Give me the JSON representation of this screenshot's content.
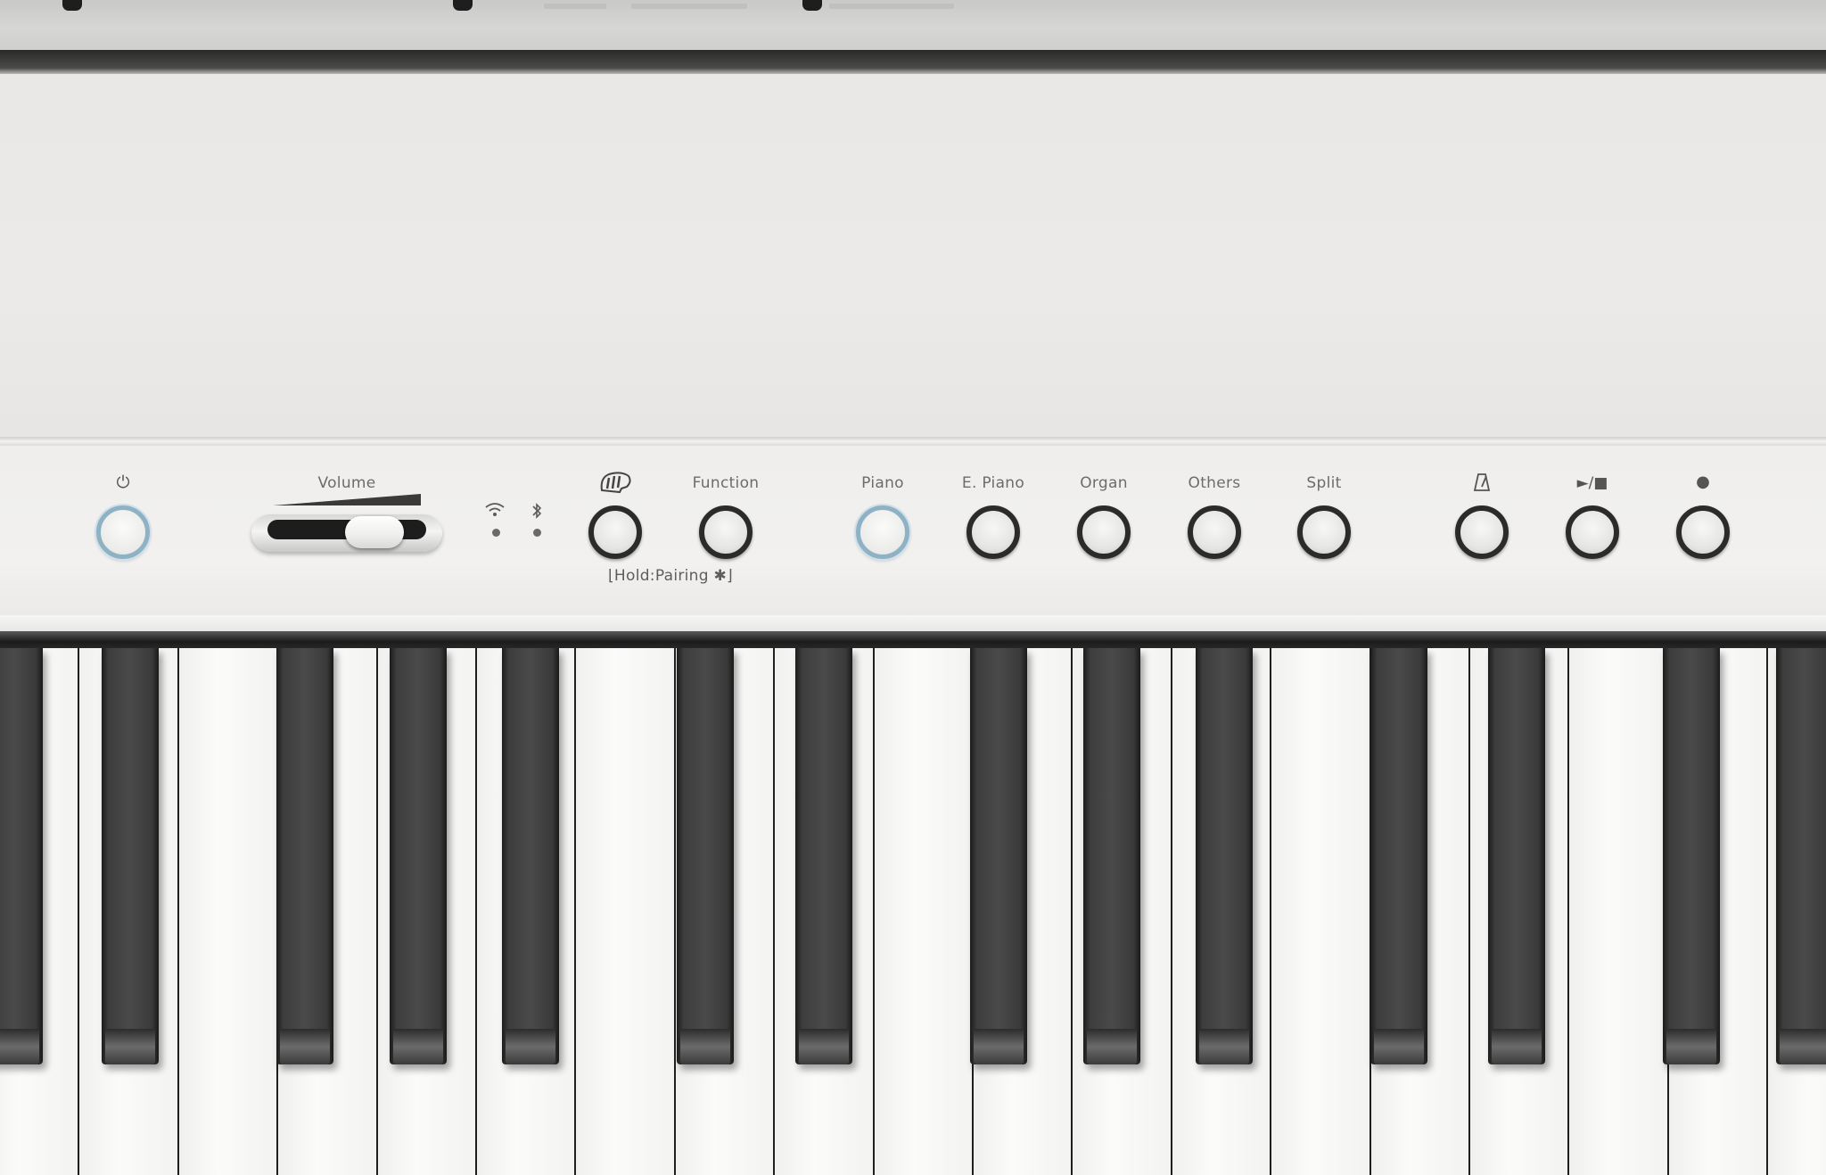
{
  "panel": {
    "power": {
      "symbol": "⏻",
      "lit": true
    },
    "volume": {
      "label": "Volume",
      "level": 0.78
    },
    "indicators": {
      "wifi_icon": "wifi-icon",
      "bluetooth_icon": "bluetooth-icon"
    },
    "twin_piano_icon": "twin-piano-icon",
    "function_label": "Function",
    "pairing_note": "⌊Hold:Pairing ✱⌋",
    "tones": [
      {
        "label": "Piano",
        "lit": true
      },
      {
        "label": "E. Piano",
        "lit": false
      },
      {
        "label": "Organ",
        "lit": false
      },
      {
        "label": "Others",
        "lit": false
      },
      {
        "label": "Split",
        "lit": false
      }
    ],
    "metronome_icon": "metronome-icon",
    "play_stop_symbol": "►/■",
    "record_symbol": "●"
  }
}
